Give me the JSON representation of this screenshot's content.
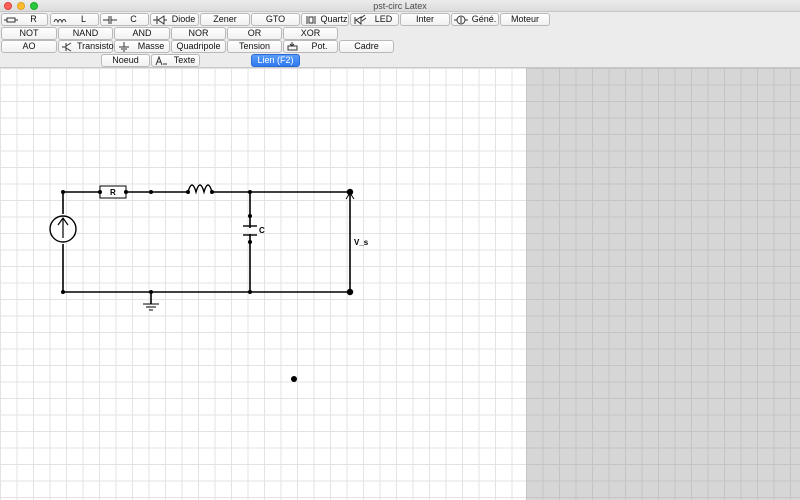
{
  "window": {
    "title": "pst-circ Latex",
    "traffic_lights": {
      "close": "#fe5f57",
      "minimize": "#febc2e",
      "zoom": "#28c840"
    }
  },
  "toolbar": {
    "row1": [
      "R",
      "L",
      "C",
      "Diode",
      "Zener",
      "GTO",
      "Quartz",
      "LED",
      "Inter",
      "Géné.",
      "Moteur"
    ],
    "row2": [
      "NOT",
      "NAND",
      "AND",
      "NOR",
      "OR",
      "XOR"
    ],
    "row3": [
      "AO",
      "Transistor",
      "Masse",
      "Quadripole",
      "Tension",
      "Pot.",
      "Cadre"
    ],
    "row4": [
      "Noeud",
      "Texte",
      "Lien (F2)"
    ],
    "active": "Lien (F2)",
    "active_color": "#2f7af0"
  },
  "circuit": {
    "resistor_label": "R",
    "capacitor_label": "C",
    "output_label": "V_s"
  }
}
